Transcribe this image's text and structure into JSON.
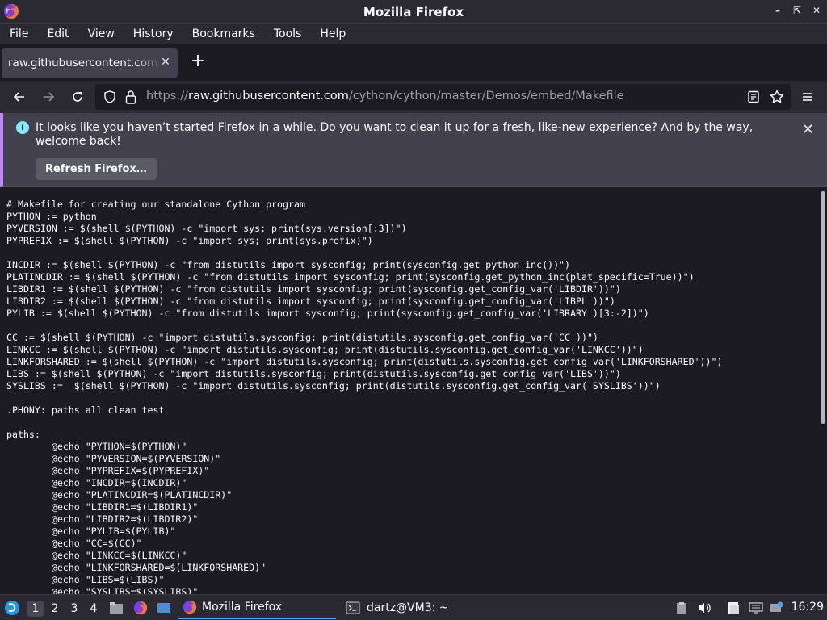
{
  "window": {
    "title": "Mozilla Firefox"
  },
  "menu": [
    "File",
    "Edit",
    "View",
    "History",
    "Bookmarks",
    "Tools",
    "Help"
  ],
  "tab": {
    "title": "raw.githubusercontent.com/cython/cython/master/Demos/embed/Makefile"
  },
  "url": {
    "scheme": "https://",
    "host": "raw.githubusercontent.com",
    "path": "/cython/cython/master/Demos/embed/Makefile"
  },
  "notification": {
    "message": "It looks like you haven’t started Firefox in a while. Do you want to clean it up for a fresh, like-new experience? And by the way, welcome back!",
    "button": "Refresh Firefox…"
  },
  "source_lines": [
    "# Makefile for creating our standalone Cython program",
    "PYTHON := python",
    "PYVERSION := $(shell $(PYTHON) -c \"import sys; print(sys.version[:3])\")",
    "PYPREFIX := $(shell $(PYTHON) -c \"import sys; print(sys.prefix)\")",
    "",
    "INCDIR := $(shell $(PYTHON) -c \"from distutils import sysconfig; print(sysconfig.get_python_inc())\")",
    "PLATINCDIR := $(shell $(PYTHON) -c \"from distutils import sysconfig; print(sysconfig.get_python_inc(plat_specific=True))\")",
    "LIBDIR1 := $(shell $(PYTHON) -c \"from distutils import sysconfig; print(sysconfig.get_config_var('LIBDIR'))\")",
    "LIBDIR2 := $(shell $(PYTHON) -c \"from distutils import sysconfig; print(sysconfig.get_config_var('LIBPL'))\")",
    "PYLIB := $(shell $(PYTHON) -c \"from distutils import sysconfig; print(sysconfig.get_config_var('LIBRARY')[3:-2])\")",
    "",
    "CC := $(shell $(PYTHON) -c \"import distutils.sysconfig; print(distutils.sysconfig.get_config_var('CC'))\")",
    "LINKCC := $(shell $(PYTHON) -c \"import distutils.sysconfig; print(distutils.sysconfig.get_config_var('LINKCC'))\")",
    "LINKFORSHARED := $(shell $(PYTHON) -c \"import distutils.sysconfig; print(distutils.sysconfig.get_config_var('LINKFORSHARED'))\")",
    "LIBS := $(shell $(PYTHON) -c \"import distutils.sysconfig; print(distutils.sysconfig.get_config_var('LIBS'))\")",
    "SYSLIBS :=  $(shell $(PYTHON) -c \"import distutils.sysconfig; print(distutils.sysconfig.get_config_var('SYSLIBS'))\")",
    "",
    ".PHONY: paths all clean test",
    "",
    "paths:",
    "\t@echo \"PYTHON=$(PYTHON)\"",
    "\t@echo \"PYVERSION=$(PYVERSION)\"",
    "\t@echo \"PYPREFIX=$(PYPREFIX)\"",
    "\t@echo \"INCDIR=$(INCDIR)\"",
    "\t@echo \"PLATINCDIR=$(PLATINCDIR)\"",
    "\t@echo \"LIBDIR1=$(LIBDIR1)\"",
    "\t@echo \"LIBDIR2=$(LIBDIR2)\"",
    "\t@echo \"PYLIB=$(PYLIB)\"",
    "\t@echo \"CC=$(CC)\"",
    "\t@echo \"LINKCC=$(LINKCC)\"",
    "\t@echo \"LINKFORSHARED=$(LINKFORSHARED)\"",
    "\t@echo \"LIBS=$(LIBS)\"",
    "\t@echo \"SYSLIBS=$(SYSLIBS)\""
  ],
  "taskbar": {
    "workspaces": [
      "1",
      "2",
      "3",
      "4"
    ],
    "tasks": [
      {
        "label": "Mozilla Firefox",
        "icon": "firefox-icon"
      },
      {
        "label": "dartz@VM3: ~",
        "icon": "terminal-icon"
      }
    ],
    "clock": "16:29"
  }
}
